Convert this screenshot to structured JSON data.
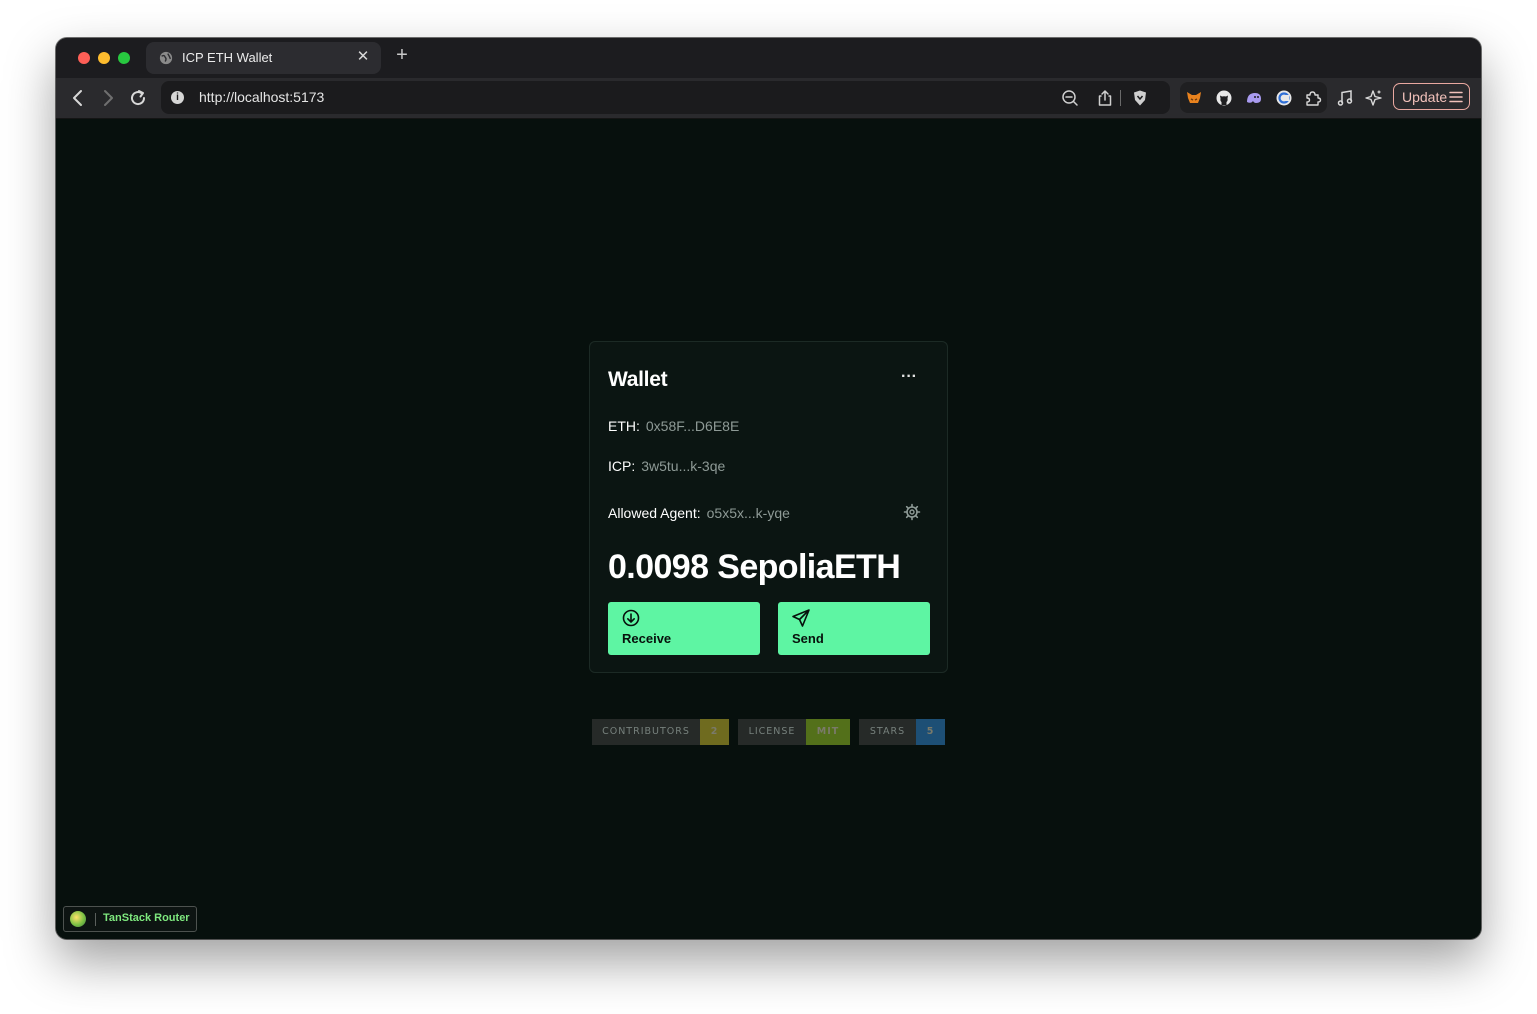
{
  "browser": {
    "tab": {
      "title": "ICP ETH Wallet",
      "favicon": "globe-icon",
      "close_symbol": "✕"
    },
    "new_tab_symbol": "+",
    "url": "http://localhost:5173",
    "update_label": "Update",
    "accent_update": "#e9a8a0"
  },
  "wallet": {
    "title": "Wallet",
    "more_symbol": "···",
    "eth_label": "ETH:",
    "eth_value": "0x58F...D6E8E",
    "icp_label": "ICP:",
    "icp_value": "3w5tu...k-3qe",
    "agent_label": "Allowed Agent:",
    "agent_value": "o5x5x...k-yqe",
    "balance": "0.0098 SepoliaETH",
    "receive_label": "Receive",
    "send_label": "Send",
    "accent": "#5ef5a3"
  },
  "badges": [
    {
      "label": "CONTRIBUTORS",
      "value": "2",
      "color": "#6f6b1f"
    },
    {
      "label": "LICENSE",
      "value": "MIT",
      "color": "#53701a"
    },
    {
      "label": "STARS",
      "value": "5",
      "color": "#1d4f75"
    }
  ],
  "devtools": {
    "label": "TanStack Router"
  }
}
